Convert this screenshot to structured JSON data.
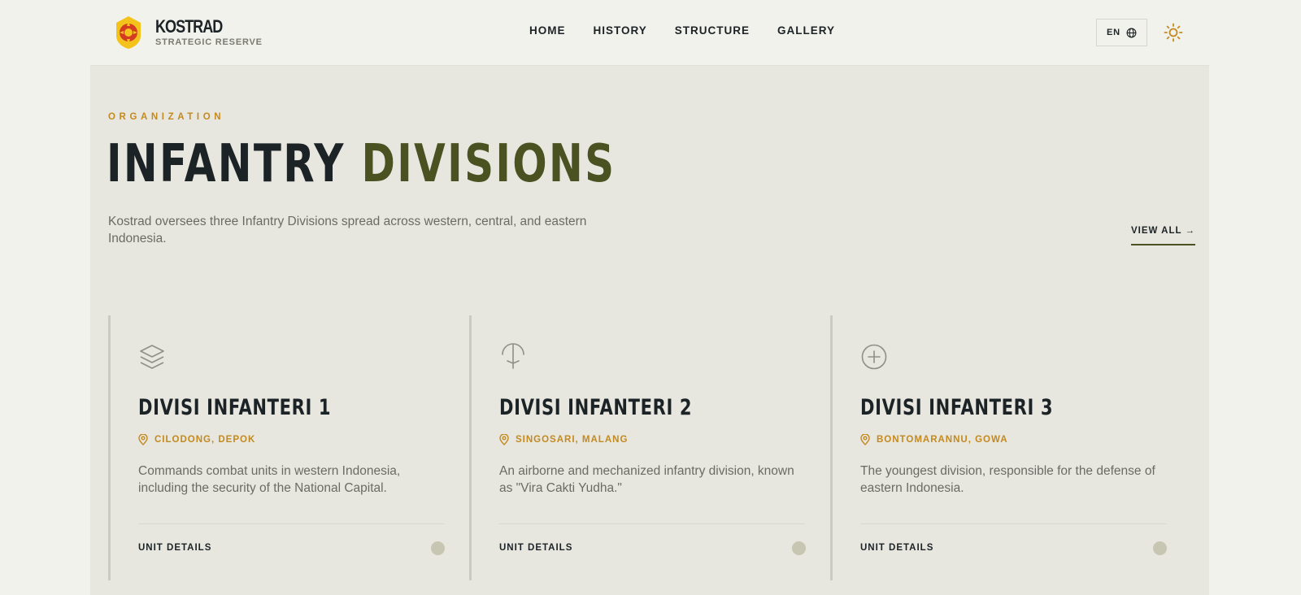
{
  "brand": {
    "name": "KOSTRAD",
    "subtitle": "STRATEGIC RESERVE",
    "logo_icon": "kostrad-emblem"
  },
  "nav": {
    "items": [
      "HOME",
      "HISTORY",
      "STRUCTURE",
      "GALLERY"
    ]
  },
  "lang": {
    "label": "EN",
    "icon": "globe-icon"
  },
  "theme": {
    "icon": "sun-icon"
  },
  "colors": {
    "accent": "#c38a1f",
    "olive": "#4a5222",
    "ink": "#1c2326",
    "panel": "#e7e6df"
  },
  "section": {
    "eyebrow": "ORGANIZATION",
    "title_part1": "INFANTRY",
    "title_part2": "DIVISIONS",
    "lead": "Kostrad oversees three Infantry Divisions spread across western, central, and eastern Indonesia.",
    "view_all": "VIEW ALL →"
  },
  "cards": [
    {
      "icon": "layers-icon",
      "title": "DIVISI INFANTERI 1",
      "location": "CILODONG, DEPOK",
      "desc": "Commands combat units in western Indonesia, including the security of the National Capital.",
      "link": "UNIT DETAILS"
    },
    {
      "icon": "parachute-icon",
      "title": "DIVISI INFANTERI 2",
      "location": "SINGOSARI, MALANG",
      "desc": "An airborne and mechanized infantry division, known as \"Vira Cakti Yudha.\"",
      "link": "UNIT DETAILS"
    },
    {
      "icon": "plus-circle-icon",
      "title": "DIVISI INFANTERI 3",
      "location": "BONTOMARANNU, GOWA",
      "desc": "The youngest division, responsible for the defense of eastern Indonesia.",
      "link": "UNIT DETAILS"
    }
  ]
}
